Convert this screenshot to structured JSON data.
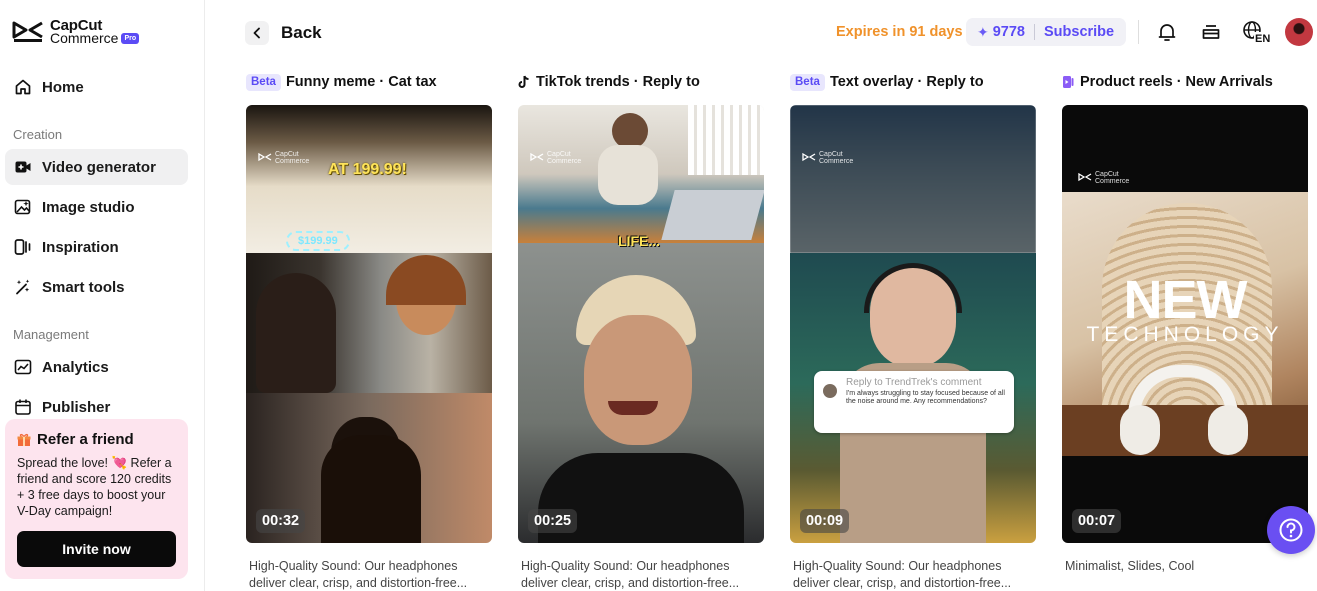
{
  "brand": {
    "name_line1": "CapCut",
    "name_line2": "Commerce",
    "badge": "Pro"
  },
  "sidebar": {
    "home": "Home",
    "creation_label": "Creation",
    "creation": [
      {
        "label": "Video generator",
        "icon": "video-plus-icon",
        "active": true
      },
      {
        "label": "Image studio",
        "icon": "image-spark-icon"
      },
      {
        "label": "Inspiration",
        "icon": "inspiration-icon"
      },
      {
        "label": "Smart tools",
        "icon": "magic-wand-icon"
      }
    ],
    "management_label": "Management",
    "management": [
      {
        "label": "Analytics",
        "icon": "analytics-icon"
      },
      {
        "label": "Publisher",
        "icon": "calendar-icon"
      }
    ],
    "refer": {
      "title": "Refer a friend",
      "body": "Spread the love! 💘 Refer a friend and score 120 credits + 3 free days to boost your V-Day campaign!",
      "button": "Invite now"
    }
  },
  "header": {
    "back": "Back",
    "expires": "Expires in 91 days",
    "credits": "9778",
    "subscribe": "Subscribe",
    "language": "EN"
  },
  "cards": [
    {
      "badge": "Beta",
      "title": "Funny meme · Cat tax",
      "duration": "00:32",
      "overlay_text_1": "AT 199.99!",
      "overlay_text_2": "$199.99",
      "description": "High-Quality Sound: Our headphones deliver clear, crisp, and distortion-free..."
    },
    {
      "icon": "tiktok-icon",
      "title": "TikTok trends · Reply to",
      "duration": "00:25",
      "overlay_text_1": "LIFE...",
      "description": "High-Quality Sound: Our headphones deliver clear, crisp, and distortion-free..."
    },
    {
      "badge": "Beta",
      "title": "Text overlay · Reply to",
      "duration": "00:09",
      "comment_title": "Reply to TrendTrek's comment",
      "comment_body": "I'm always struggling to stay focused because of all the noise around me. Any recommendations?",
      "description": "High-Quality Sound: Our headphones deliver clear, crisp, and distortion-free..."
    },
    {
      "icon": "product-reels-icon",
      "title": "Product reels · New Arrivals",
      "duration": "00:07",
      "overlay_text_1": "NEW",
      "overlay_text_2": "TECHNOLOGY",
      "description": "Minimalist, Slides, Cool"
    }
  ],
  "watermark": {
    "line1": "CapCut",
    "line2": "Commerce"
  },
  "colors": {
    "accent": "#5b4bf5",
    "expires": "#f0922b",
    "refer_bg": "#fde4ee",
    "help": "#6a4ff2"
  }
}
